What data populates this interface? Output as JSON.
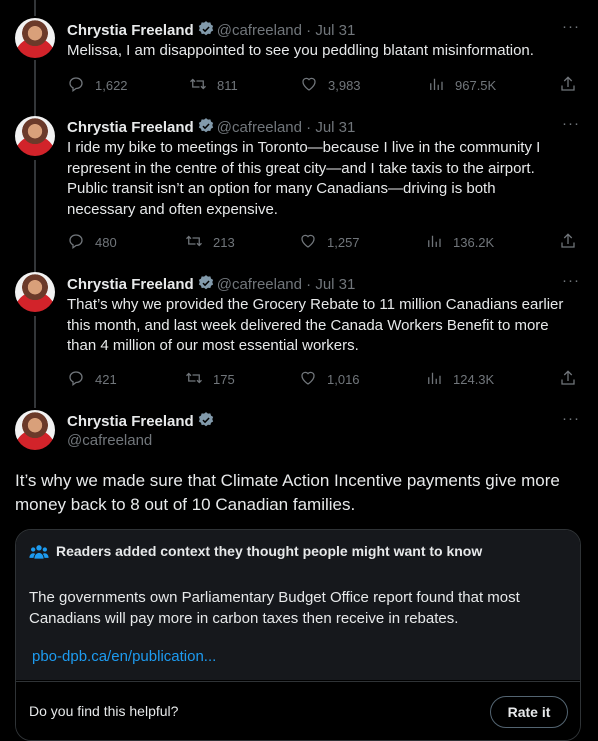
{
  "tweets": [
    {
      "name": "Chrystia Freeland",
      "handle": "@cafreeland",
      "sep": "·",
      "date": "Jul 31",
      "text": "Melissa, I am disappointed to see you peddling blatant misinformation.",
      "replies": "1,622",
      "retweets": "811",
      "likes": "3,983",
      "views": "967.5K"
    },
    {
      "name": "Chrystia Freeland",
      "handle": "@cafreeland",
      "sep": "·",
      "date": "Jul 31",
      "text": "I ride my bike to meetings in Toronto—because I live in the community I represent in the centre of this great city—and I take taxis to the airport. Public transit isn’t an option for many Canadians—driving is both necessary and often expensive.",
      "replies": "480",
      "retweets": "213",
      "likes": "1,257",
      "views": "136.2K"
    },
    {
      "name": "Chrystia Freeland",
      "handle": "@cafreeland",
      "sep": "·",
      "date": "Jul 31",
      "text": "That’s why we provided the Grocery Rebate to 11 million Canadians earlier this month, and last week delivered the Canada Workers Benefit to more than 4 million of our most essential workers.",
      "replies": "421",
      "retweets": "175",
      "likes": "1,016",
      "views": "124.3K"
    }
  ],
  "main": {
    "name": "Chrystia Freeland",
    "handle": "@cafreeland",
    "text": "It’s why we made sure that Climate Action Incentive payments give more money back to 8 out of 10 Canadian families."
  },
  "note": {
    "title": "Readers added context they thought people might want to know",
    "text": "The governments own Parliamentary Budget Office report found that most Canadians will pay more in carbon taxes then receive in rebates.",
    "link": "pbo-dpb.ca/en/publication...",
    "question": "Do you find this helpful?",
    "rate_label": "Rate it"
  },
  "icons": {
    "verified": "verified-badge-icon",
    "reply": "reply-icon",
    "retweet": "retweet-icon",
    "like": "heart-icon",
    "views": "views-bar-chart-icon",
    "share": "share-icon",
    "more": "more-dots-icon",
    "community": "people-icon"
  },
  "colors": {
    "link": "#1d9bf0",
    "muted": "#71767b",
    "background": "#000000"
  }
}
